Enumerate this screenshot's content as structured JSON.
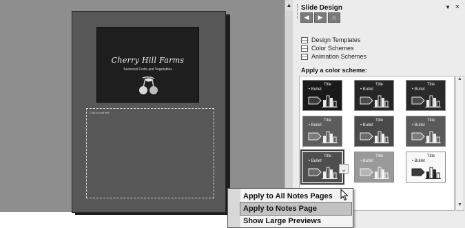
{
  "slide": {
    "title": "Cherry Hill Farms",
    "subtitle": "Seasonal Fruits and Vegetables",
    "notes_placeholder": "Click to add text"
  },
  "task_pane": {
    "title": "Slide Design",
    "menu_arrow": "▼",
    "close": "×",
    "nav_icons": [
      "back-icon",
      "forward-icon",
      "home-icon"
    ],
    "links": [
      "Design Templates",
      "Color Schemes",
      "Animation Schemes"
    ],
    "section_header": "Apply a color scheme:"
  },
  "scheme_sample": {
    "title": "Title",
    "bullet": "• Bullet"
  },
  "schemes": [
    {
      "bg": "#1a1a1a",
      "text": "#e8e8e8",
      "shape": "#3a3a3a"
    },
    {
      "bg": "#262626",
      "text": "#e8e8e8",
      "shape": "#4a4a4a"
    },
    {
      "bg": "#2a2a2a",
      "text": "#e8e8e8",
      "shape": "#4a4a4a"
    },
    {
      "bg": "#5c5c5c",
      "text": "#f0f0f0",
      "shape": "#7a7a7a"
    },
    {
      "bg": "#4a4a4a",
      "text": "#f0f0f0",
      "shape": "#6a6a6a"
    },
    {
      "bg": "#5a5a5a",
      "text": "#f0f0f0",
      "shape": "#7a7a7a"
    },
    {
      "bg": "#4e4e4e",
      "text": "#f0f0f0",
      "shape": "#6a6a6a"
    },
    {
      "bg": "#9a9a9a",
      "text": "#f4f4f4",
      "shape": "#b4b4b4"
    },
    {
      "bg": "#f8f8f8",
      "text": "#222222",
      "shape": "#3a3a3a"
    }
  ],
  "context_menu": {
    "items": [
      "Apply to All Notes Pages",
      "Apply to Notes Page",
      "Show Large Previews"
    ],
    "hover_index": 1
  },
  "colors": {
    "workspace": "#8e8e8e",
    "page": "#575757",
    "pane": "#ececec"
  }
}
